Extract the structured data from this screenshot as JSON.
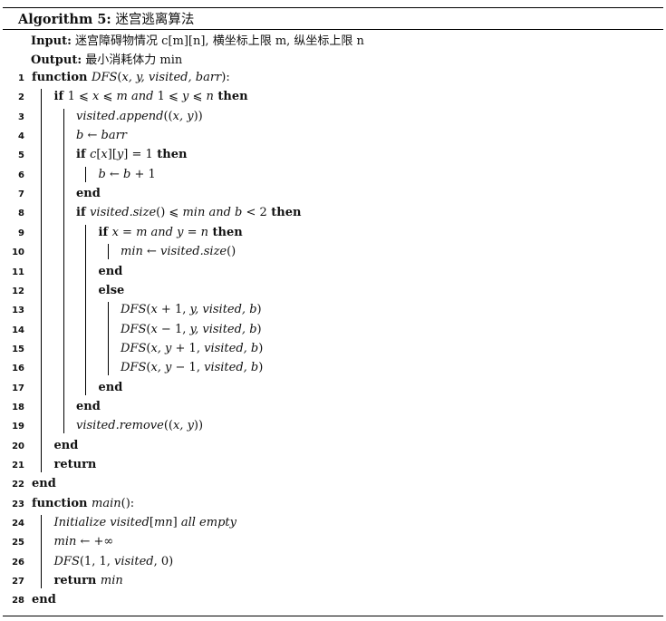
{
  "algorithm": {
    "title_label": "Algorithm 5:",
    "title_text": "迷宫逃离算法",
    "input_label": "Input:",
    "input_text": "迷宫障碍物情况 c[m][n], 横坐标上限 m, 纵坐标上限 n",
    "output_label": "Output:",
    "output_text": "最小消耗体力 min",
    "lines": [
      {
        "num": "1",
        "indent": 0,
        "tokens": [
          {
            "t": "function ",
            "s": "kw"
          },
          {
            "t": "DFS",
            "s": "it"
          },
          {
            "t": "(",
            "s": ""
          },
          {
            "t": "x, y, visited, barr",
            "s": "it"
          },
          {
            "t": "):",
            "s": ""
          }
        ]
      },
      {
        "num": "2",
        "indent": 1,
        "tokens": [
          {
            "t": "if ",
            "s": "kw"
          },
          {
            "t": "1 ⩽ ",
            "s": ""
          },
          {
            "t": "x",
            "s": "it"
          },
          {
            "t": " ⩽ ",
            "s": ""
          },
          {
            "t": "m and ",
            "s": "it"
          },
          {
            "t": "1 ⩽ ",
            "s": ""
          },
          {
            "t": "y",
            "s": "it"
          },
          {
            "t": " ⩽ ",
            "s": ""
          },
          {
            "t": "n",
            "s": "it"
          },
          {
            "t": " then",
            "s": "kw"
          }
        ]
      },
      {
        "num": "3",
        "indent": 2,
        "tokens": [
          {
            "t": "visited.append",
            "s": "it"
          },
          {
            "t": "((",
            "s": ""
          },
          {
            "t": "x, y",
            "s": "it"
          },
          {
            "t": "))",
            "s": ""
          }
        ]
      },
      {
        "num": "4",
        "indent": 2,
        "tokens": [
          {
            "t": "b",
            "s": "it"
          },
          {
            "t": " ← ",
            "s": ""
          },
          {
            "t": "barr",
            "s": "it"
          }
        ]
      },
      {
        "num": "5",
        "indent": 2,
        "tokens": [
          {
            "t": "if ",
            "s": "kw"
          },
          {
            "t": "c",
            "s": "it"
          },
          {
            "t": "[",
            "s": ""
          },
          {
            "t": "x",
            "s": "it"
          },
          {
            "t": "][",
            "s": ""
          },
          {
            "t": "y",
            "s": "it"
          },
          {
            "t": "] = 1",
            "s": ""
          },
          {
            "t": " then",
            "s": "kw"
          }
        ]
      },
      {
        "num": "6",
        "indent": 3,
        "tokens": [
          {
            "t": "b",
            "s": "it"
          },
          {
            "t": " ← ",
            "s": ""
          },
          {
            "t": "b",
            "s": "it"
          },
          {
            "t": " + 1",
            "s": ""
          }
        ]
      },
      {
        "num": "7",
        "indent": 2,
        "tokens": [
          {
            "t": "end",
            "s": "kw"
          }
        ]
      },
      {
        "num": "8",
        "indent": 2,
        "tokens": [
          {
            "t": "if ",
            "s": "kw"
          },
          {
            "t": "visited.size",
            "s": "it"
          },
          {
            "t": "() ⩽ ",
            "s": ""
          },
          {
            "t": "min and b",
            "s": "it"
          },
          {
            "t": " < 2",
            "s": ""
          },
          {
            "t": " then",
            "s": "kw"
          }
        ]
      },
      {
        "num": "9",
        "indent": 3,
        "tokens": [
          {
            "t": "if ",
            "s": "kw"
          },
          {
            "t": "x",
            "s": "it"
          },
          {
            "t": " = ",
            "s": ""
          },
          {
            "t": "m and y",
            "s": "it"
          },
          {
            "t": " = ",
            "s": ""
          },
          {
            "t": "n",
            "s": "it"
          },
          {
            "t": " then",
            "s": "kw"
          }
        ]
      },
      {
        "num": "10",
        "indent": 4,
        "tokens": [
          {
            "t": "min",
            "s": "it"
          },
          {
            "t": " ← ",
            "s": ""
          },
          {
            "t": "visited.size",
            "s": "it"
          },
          {
            "t": "()",
            "s": ""
          }
        ]
      },
      {
        "num": "11",
        "indent": 3,
        "tokens": [
          {
            "t": "end",
            "s": "kw"
          }
        ]
      },
      {
        "num": "12",
        "indent": 3,
        "tokens": [
          {
            "t": "else",
            "s": "kw"
          }
        ]
      },
      {
        "num": "13",
        "indent": 4,
        "tokens": [
          {
            "t": "DFS",
            "s": "it"
          },
          {
            "t": "(",
            "s": ""
          },
          {
            "t": "x",
            "s": "it"
          },
          {
            "t": " + 1, ",
            "s": ""
          },
          {
            "t": "y, visited, b",
            "s": "it"
          },
          {
            "t": ")",
            "s": ""
          }
        ]
      },
      {
        "num": "14",
        "indent": 4,
        "tokens": [
          {
            "t": "DFS",
            "s": "it"
          },
          {
            "t": "(",
            "s": ""
          },
          {
            "t": "x",
            "s": "it"
          },
          {
            "t": " − 1, ",
            "s": ""
          },
          {
            "t": "y, visited, b",
            "s": "it"
          },
          {
            "t": ")",
            "s": ""
          }
        ]
      },
      {
        "num": "15",
        "indent": 4,
        "tokens": [
          {
            "t": "DFS",
            "s": "it"
          },
          {
            "t": "(",
            "s": ""
          },
          {
            "t": "x, y",
            "s": "it"
          },
          {
            "t": " + 1, ",
            "s": ""
          },
          {
            "t": "visited, b",
            "s": "it"
          },
          {
            "t": ")",
            "s": ""
          }
        ]
      },
      {
        "num": "16",
        "indent": 4,
        "tokens": [
          {
            "t": "DFS",
            "s": "it"
          },
          {
            "t": "(",
            "s": ""
          },
          {
            "t": "x, y",
            "s": "it"
          },
          {
            "t": " − 1, ",
            "s": ""
          },
          {
            "t": "visited, b",
            "s": "it"
          },
          {
            "t": ")",
            "s": ""
          }
        ]
      },
      {
        "num": "17",
        "indent": 3,
        "tokens": [
          {
            "t": "end",
            "s": "kw"
          }
        ]
      },
      {
        "num": "18",
        "indent": 2,
        "tokens": [
          {
            "t": "end",
            "s": "kw"
          }
        ]
      },
      {
        "num": "19",
        "indent": 2,
        "tokens": [
          {
            "t": "visited.remove",
            "s": "it"
          },
          {
            "t": "((",
            "s": ""
          },
          {
            "t": "x, y",
            "s": "it"
          },
          {
            "t": "))",
            "s": ""
          }
        ]
      },
      {
        "num": "20",
        "indent": 1,
        "tokens": [
          {
            "t": "end",
            "s": "kw"
          }
        ]
      },
      {
        "num": "21",
        "indent": 1,
        "tokens": [
          {
            "t": "return",
            "s": "kw"
          }
        ]
      },
      {
        "num": "22",
        "indent": 0,
        "tokens": [
          {
            "t": "end",
            "s": "kw"
          }
        ]
      },
      {
        "num": "23",
        "indent": 0,
        "tokens": [
          {
            "t": "function ",
            "s": "kw"
          },
          {
            "t": "main",
            "s": "it"
          },
          {
            "t": "():",
            "s": ""
          }
        ]
      },
      {
        "num": "24",
        "indent": 1,
        "tokens": [
          {
            "t": "Initialize visited",
            "s": "it"
          },
          {
            "t": "[",
            "s": ""
          },
          {
            "t": "mn",
            "s": "it"
          },
          {
            "t": "] ",
            "s": ""
          },
          {
            "t": "all empty",
            "s": "it"
          }
        ]
      },
      {
        "num": "25",
        "indent": 1,
        "tokens": [
          {
            "t": "min",
            "s": "it"
          },
          {
            "t": " ← +∞",
            "s": ""
          }
        ]
      },
      {
        "num": "26",
        "indent": 1,
        "tokens": [
          {
            "t": "DFS",
            "s": "it"
          },
          {
            "t": "(1, 1, ",
            "s": ""
          },
          {
            "t": "visited",
            "s": "it"
          },
          {
            "t": ", 0)",
            "s": ""
          }
        ]
      },
      {
        "num": "27",
        "indent": 1,
        "tokens": [
          {
            "t": "return ",
            "s": "kw"
          },
          {
            "t": "min",
            "s": "it"
          }
        ]
      },
      {
        "num": "28",
        "indent": 0,
        "tokens": [
          {
            "t": "end",
            "s": "kw"
          }
        ]
      }
    ]
  }
}
